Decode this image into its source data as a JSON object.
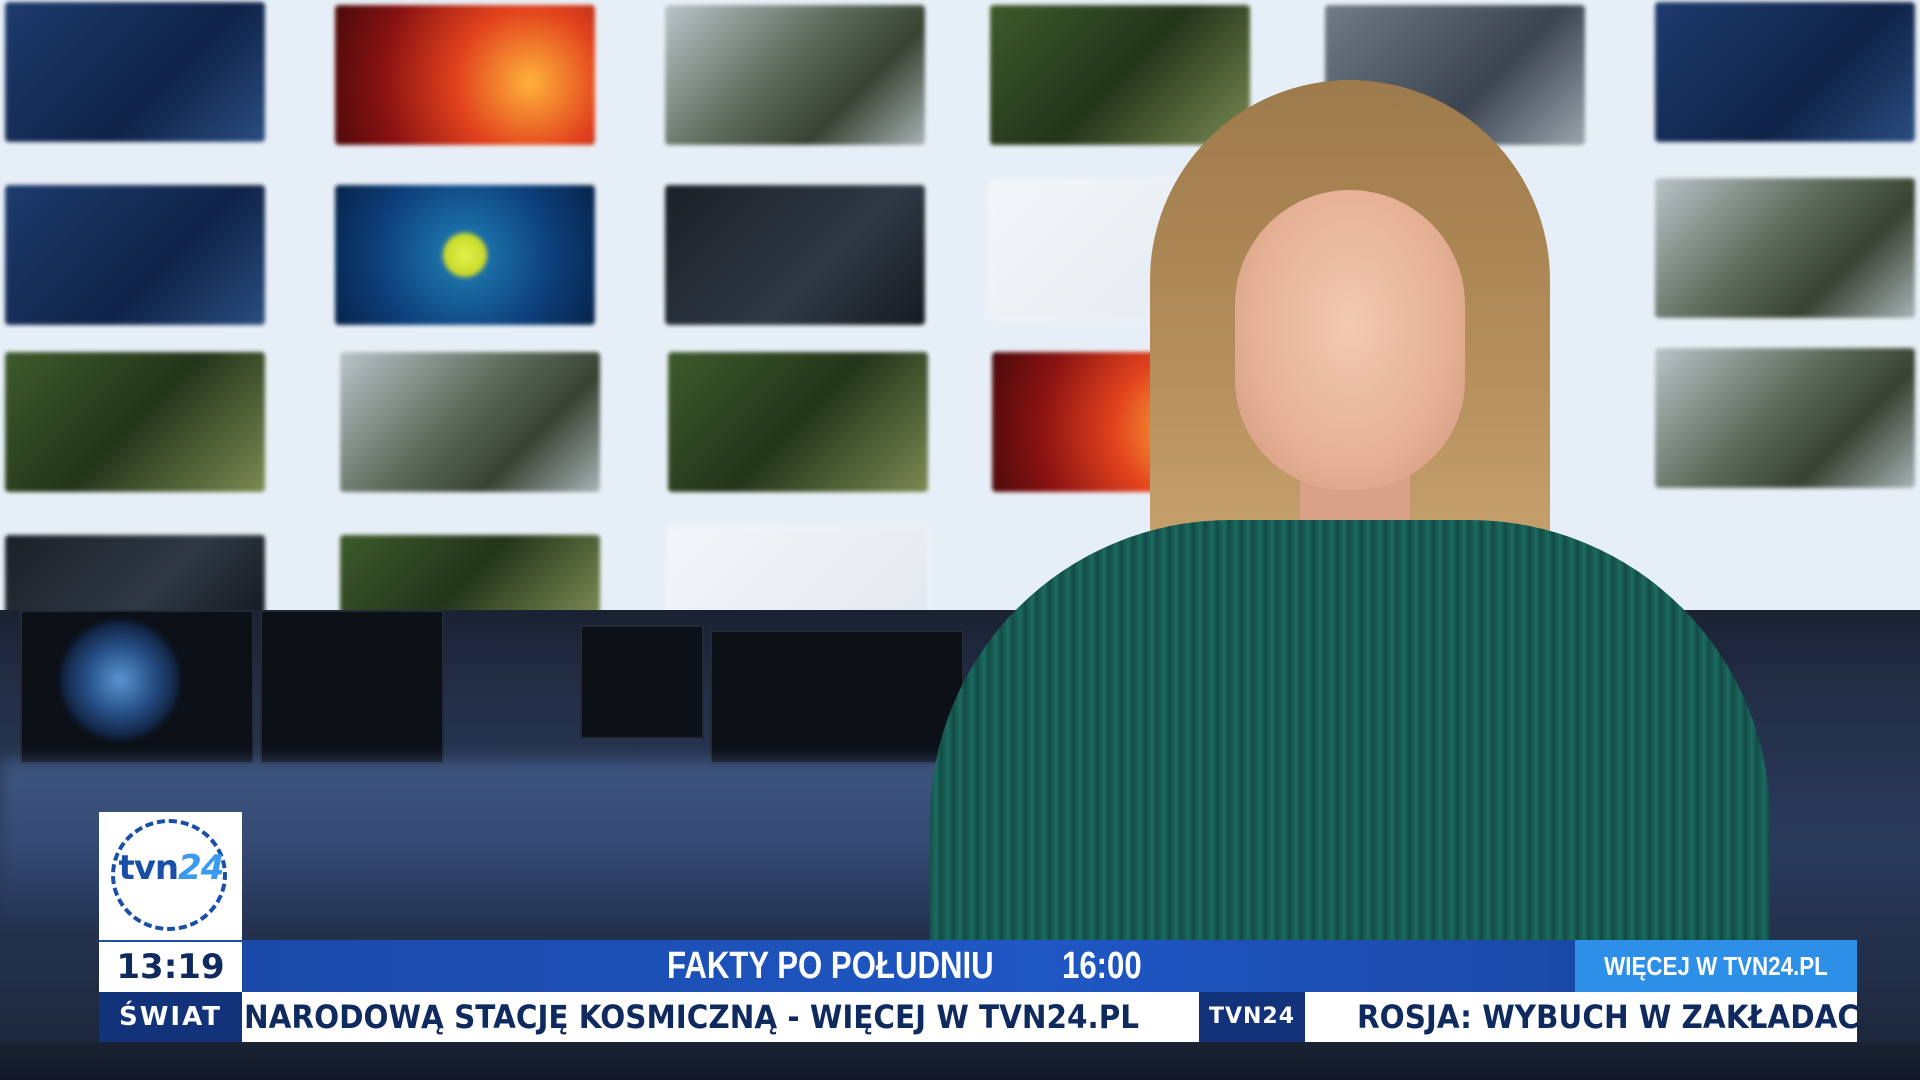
{
  "broadcast": {
    "channel_logo": {
      "word": "tvn",
      "number": "24"
    },
    "clock": "13:19",
    "promo": {
      "program": "FAKTY PO POŁUDNIU",
      "time": "16:00",
      "more": "WIĘCEJ W TVN24.PL"
    },
    "section": "ŚWIAT",
    "ticker": {
      "headline_1": "NARODOWĄ STACJĘ KOSMICZNĄ - WIĘCEJ W TVN24.PL",
      "badge": "TVN24",
      "headline_2": "ROSJA: WYBUCH W ZAKŁADAC"
    },
    "colors": {
      "primary_blue": "#1a49a8",
      "accent_blue": "#2d8fe8",
      "dark_navy": "#12327a",
      "text_navy": "#0e2a5e",
      "presenter_dress": "#1c6a60"
    }
  }
}
